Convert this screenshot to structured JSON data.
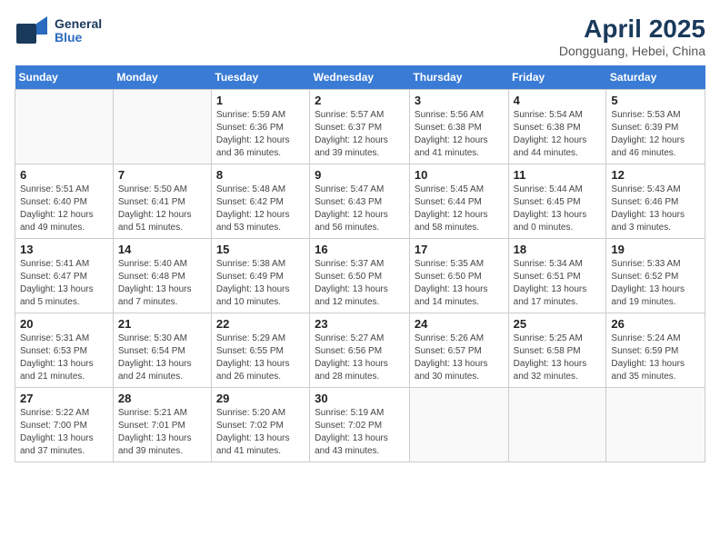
{
  "header": {
    "logo_general": "General",
    "logo_blue": "Blue",
    "title": "April 2025",
    "subtitle": "Dongguang, Hebei, China"
  },
  "weekdays": [
    "Sunday",
    "Monday",
    "Tuesday",
    "Wednesday",
    "Thursday",
    "Friday",
    "Saturday"
  ],
  "weeks": [
    [
      {
        "day": "",
        "info": ""
      },
      {
        "day": "",
        "info": ""
      },
      {
        "day": "1",
        "info": "Sunrise: 5:59 AM\nSunset: 6:36 PM\nDaylight: 12 hours\nand 36 minutes."
      },
      {
        "day": "2",
        "info": "Sunrise: 5:57 AM\nSunset: 6:37 PM\nDaylight: 12 hours\nand 39 minutes."
      },
      {
        "day": "3",
        "info": "Sunrise: 5:56 AM\nSunset: 6:38 PM\nDaylight: 12 hours\nand 41 minutes."
      },
      {
        "day": "4",
        "info": "Sunrise: 5:54 AM\nSunset: 6:38 PM\nDaylight: 12 hours\nand 44 minutes."
      },
      {
        "day": "5",
        "info": "Sunrise: 5:53 AM\nSunset: 6:39 PM\nDaylight: 12 hours\nand 46 minutes."
      }
    ],
    [
      {
        "day": "6",
        "info": "Sunrise: 5:51 AM\nSunset: 6:40 PM\nDaylight: 12 hours\nand 49 minutes."
      },
      {
        "day": "7",
        "info": "Sunrise: 5:50 AM\nSunset: 6:41 PM\nDaylight: 12 hours\nand 51 minutes."
      },
      {
        "day": "8",
        "info": "Sunrise: 5:48 AM\nSunset: 6:42 PM\nDaylight: 12 hours\nand 53 minutes."
      },
      {
        "day": "9",
        "info": "Sunrise: 5:47 AM\nSunset: 6:43 PM\nDaylight: 12 hours\nand 56 minutes."
      },
      {
        "day": "10",
        "info": "Sunrise: 5:45 AM\nSunset: 6:44 PM\nDaylight: 12 hours\nand 58 minutes."
      },
      {
        "day": "11",
        "info": "Sunrise: 5:44 AM\nSunset: 6:45 PM\nDaylight: 13 hours\nand 0 minutes."
      },
      {
        "day": "12",
        "info": "Sunrise: 5:43 AM\nSunset: 6:46 PM\nDaylight: 13 hours\nand 3 minutes."
      }
    ],
    [
      {
        "day": "13",
        "info": "Sunrise: 5:41 AM\nSunset: 6:47 PM\nDaylight: 13 hours\nand 5 minutes."
      },
      {
        "day": "14",
        "info": "Sunrise: 5:40 AM\nSunset: 6:48 PM\nDaylight: 13 hours\nand 7 minutes."
      },
      {
        "day": "15",
        "info": "Sunrise: 5:38 AM\nSunset: 6:49 PM\nDaylight: 13 hours\nand 10 minutes."
      },
      {
        "day": "16",
        "info": "Sunrise: 5:37 AM\nSunset: 6:50 PM\nDaylight: 13 hours\nand 12 minutes."
      },
      {
        "day": "17",
        "info": "Sunrise: 5:35 AM\nSunset: 6:50 PM\nDaylight: 13 hours\nand 14 minutes."
      },
      {
        "day": "18",
        "info": "Sunrise: 5:34 AM\nSunset: 6:51 PM\nDaylight: 13 hours\nand 17 minutes."
      },
      {
        "day": "19",
        "info": "Sunrise: 5:33 AM\nSunset: 6:52 PM\nDaylight: 13 hours\nand 19 minutes."
      }
    ],
    [
      {
        "day": "20",
        "info": "Sunrise: 5:31 AM\nSunset: 6:53 PM\nDaylight: 13 hours\nand 21 minutes."
      },
      {
        "day": "21",
        "info": "Sunrise: 5:30 AM\nSunset: 6:54 PM\nDaylight: 13 hours\nand 24 minutes."
      },
      {
        "day": "22",
        "info": "Sunrise: 5:29 AM\nSunset: 6:55 PM\nDaylight: 13 hours\nand 26 minutes."
      },
      {
        "day": "23",
        "info": "Sunrise: 5:27 AM\nSunset: 6:56 PM\nDaylight: 13 hours\nand 28 minutes."
      },
      {
        "day": "24",
        "info": "Sunrise: 5:26 AM\nSunset: 6:57 PM\nDaylight: 13 hours\nand 30 minutes."
      },
      {
        "day": "25",
        "info": "Sunrise: 5:25 AM\nSunset: 6:58 PM\nDaylight: 13 hours\nand 32 minutes."
      },
      {
        "day": "26",
        "info": "Sunrise: 5:24 AM\nSunset: 6:59 PM\nDaylight: 13 hours\nand 35 minutes."
      }
    ],
    [
      {
        "day": "27",
        "info": "Sunrise: 5:22 AM\nSunset: 7:00 PM\nDaylight: 13 hours\nand 37 minutes."
      },
      {
        "day": "28",
        "info": "Sunrise: 5:21 AM\nSunset: 7:01 PM\nDaylight: 13 hours\nand 39 minutes."
      },
      {
        "day": "29",
        "info": "Sunrise: 5:20 AM\nSunset: 7:02 PM\nDaylight: 13 hours\nand 41 minutes."
      },
      {
        "day": "30",
        "info": "Sunrise: 5:19 AM\nSunset: 7:02 PM\nDaylight: 13 hours\nand 43 minutes."
      },
      {
        "day": "",
        "info": ""
      },
      {
        "day": "",
        "info": ""
      },
      {
        "day": "",
        "info": ""
      }
    ]
  ]
}
